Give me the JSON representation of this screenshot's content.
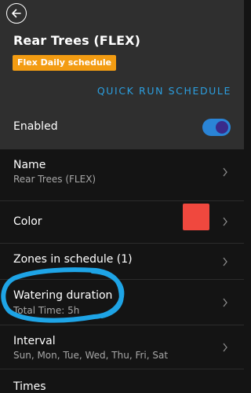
{
  "header": {
    "title": "Rear Trees (FLEX)",
    "badge": "Flex Daily schedule",
    "quick_run": "QUICK RUN SCHEDULE",
    "enabled_label": "Enabled",
    "enabled": true
  },
  "rows": [
    {
      "title": "Name",
      "subtitle": "Rear Trees (FLEX)"
    },
    {
      "title": "Color",
      "swatch_color": "#f0483e"
    },
    {
      "title": "Zones in schedule (1)"
    },
    {
      "title": "Watering duration",
      "subtitle": "Total Time: 5h"
    },
    {
      "title": "Interval",
      "subtitle": "Sun, Mon, Tue, Wed, Thu, Fri, Sat"
    },
    {
      "title": "Times"
    }
  ],
  "icons": {
    "back": "arrow-left-icon",
    "chevron": "chevron-right-icon"
  },
  "colors": {
    "accent": "#2b9fe0",
    "badge": "#f39c12",
    "annotation": "#1ea4e6"
  }
}
